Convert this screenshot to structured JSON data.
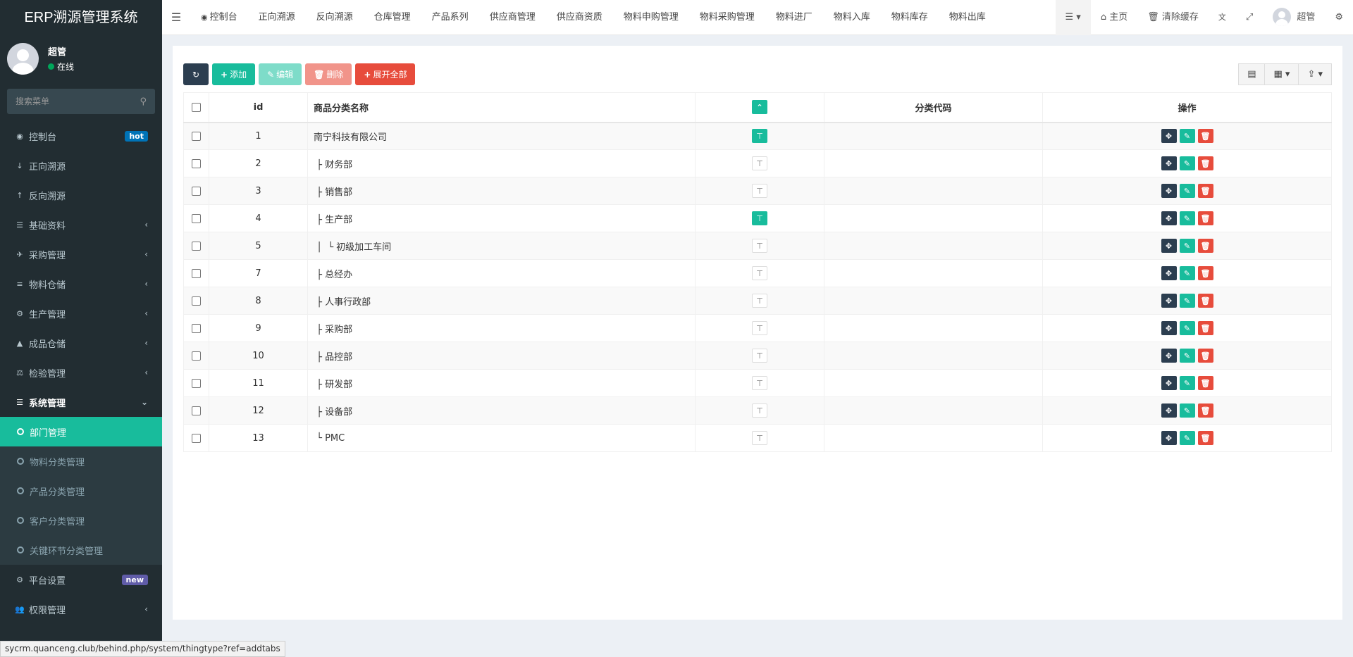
{
  "app": {
    "title": "ERP溯源管理系统"
  },
  "user": {
    "name": "超管",
    "status": "在线"
  },
  "sidebar": {
    "search_placeholder": "搜索菜单",
    "items": [
      {
        "icon": "dashboard-icon",
        "glyph": "◉",
        "label": "控制台",
        "badge": "hot"
      },
      {
        "icon": "arrow-down-icon",
        "glyph": "↓",
        "label": "正向溯源"
      },
      {
        "icon": "arrow-up-icon",
        "glyph": "↑",
        "label": "反向溯源"
      },
      {
        "icon": "list-icon",
        "glyph": "☰",
        "label": "基础资料",
        "arrow": "‹"
      },
      {
        "icon": "plane-icon",
        "glyph": "✈",
        "label": "采购管理",
        "arrow": "‹"
      },
      {
        "icon": "database-icon",
        "glyph": "≡",
        "label": "物料仓储",
        "arrow": "‹"
      },
      {
        "icon": "gears-icon",
        "glyph": "⚙",
        "label": "生产管理",
        "arrow": "‹"
      },
      {
        "icon": "road-icon",
        "glyph": "▲",
        "label": "成品仓储",
        "arrow": "‹"
      },
      {
        "icon": "balance-icon",
        "glyph": "⚖",
        "label": "检验管理",
        "arrow": "‹"
      },
      {
        "icon": "list-icon",
        "glyph": "☰",
        "label": "系统管理",
        "arrow": "⌄"
      }
    ],
    "sub_items": [
      "部门管理",
      "物料分类管理",
      "产品分类管理",
      "客户分类管理",
      "关键环节分类管理"
    ],
    "bottom_items": [
      {
        "icon": "gears-icon",
        "glyph": "⚙",
        "label": "平台设置",
        "badge": "new"
      },
      {
        "icon": "users-icon",
        "glyph": "👥",
        "label": "权限管理",
        "arrow": "‹"
      }
    ]
  },
  "header": {
    "tabs": [
      {
        "label": "控制台",
        "glyph": "◉"
      },
      {
        "label": "正向溯源"
      },
      {
        "label": "反向溯源"
      },
      {
        "label": "仓库管理"
      },
      {
        "label": "产品系列"
      },
      {
        "label": "供应商管理"
      },
      {
        "label": "供应商资质"
      },
      {
        "label": "物料申购管理"
      },
      {
        "label": "物料采购管理"
      },
      {
        "label": "物料进厂"
      },
      {
        "label": "物料入库"
      },
      {
        "label": "物料库存"
      },
      {
        "label": "物料出库"
      }
    ],
    "home": "主页",
    "clear_cache": "清除缓存",
    "user": "超管"
  },
  "toolbar": {
    "add": "添加",
    "edit": "编辑",
    "delete": "删除",
    "expand_all": "展开全部"
  },
  "table": {
    "columns": [
      "id",
      "商品分类名称",
      "",
      "分类代码",
      "操作"
    ],
    "rows": [
      {
        "id": "1",
        "name": "南宁科技有限公司",
        "expanded": true
      },
      {
        "id": "2",
        "name": " ├ 财务部",
        "expanded": false
      },
      {
        "id": "3",
        "name": " ├ 销售部",
        "expanded": false
      },
      {
        "id": "4",
        "name": " ├ 生产部",
        "expanded": true
      },
      {
        "id": "5",
        "name": " │  └ 初级加工车间",
        "expanded": false
      },
      {
        "id": "7",
        "name": " ├ 总经办",
        "expanded": false
      },
      {
        "id": "8",
        "name": " ├ 人事行政部",
        "expanded": false
      },
      {
        "id": "9",
        "name": " ├ 采购部",
        "expanded": false
      },
      {
        "id": "10",
        "name": " ├ 品控部",
        "expanded": false
      },
      {
        "id": "11",
        "name": " ├ 研发部",
        "expanded": false
      },
      {
        "id": "12",
        "name": " ├ 设备部",
        "expanded": false
      },
      {
        "id": "13",
        "name": " └ PMC",
        "expanded": false
      }
    ]
  },
  "status_url": "sycrm.quanceng.club/behind.php/system/thingtype?ref=addtabs"
}
